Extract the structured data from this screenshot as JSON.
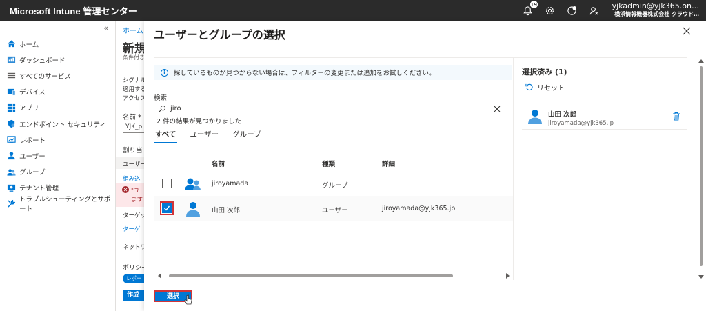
{
  "app": {
    "title": "Microsoft Intune 管理センター",
    "notification_count": "19",
    "account_name": "yjkadmin@yjk365.on…",
    "account_org": "横浜情報機器株式会社 クラウド…"
  },
  "nav": {
    "collapse_glyph": "«",
    "items": [
      {
        "label": "ホーム",
        "icon": "home-icon"
      },
      {
        "label": "ダッシュボード",
        "icon": "dashboard-icon"
      },
      {
        "label": "すべてのサービス",
        "icon": "list-icon"
      },
      {
        "label": "デバイス",
        "icon": "device-icon"
      },
      {
        "label": "アプリ",
        "icon": "apps-grid-icon"
      },
      {
        "label": "エンドポイント セキュリティ",
        "icon": "shield-icon"
      },
      {
        "label": "レポート",
        "icon": "report-icon"
      },
      {
        "label": "ユーザー",
        "icon": "user-icon"
      },
      {
        "label": "グループ",
        "icon": "group-icon"
      },
      {
        "label": "テナント管理",
        "icon": "tenant-icon"
      },
      {
        "label": "トラブルシューティングとサポート",
        "icon": "wrench-icon"
      }
    ]
  },
  "background_blade": {
    "breadcrumb": "ホーム >",
    "title": "新規",
    "subtitle": "条件付き",
    "desc1": "シグナル",
    "desc2": "適用する",
    "desc3": "アクセス",
    "name_label": "名前 *",
    "name_value": "YJK_p",
    "assign_label": "割り当て",
    "users_label": "ユーザー",
    "include_label": "組み込",
    "error1": "\"ユー",
    "error2": "ます",
    "target_label": "ターゲット",
    "target_link": "ターゲ",
    "network_label": "ネットワー",
    "policy_label": "ポリシー",
    "policy_pill": "レポー",
    "create_button": "作成"
  },
  "panel": {
    "title": "ユーザーとグループの選択",
    "info_text": "探しているものが見つからない場合は、フィルターの変更または追加をお試しください。",
    "search_label": "検索",
    "search_value": "jiro",
    "result_count": "2 件の結果が見つかりました",
    "tabs": [
      {
        "label": "すべて",
        "active": true
      },
      {
        "label": "ユーザー",
        "active": false
      },
      {
        "label": "グループ",
        "active": false
      }
    ],
    "columns": {
      "name": "名前",
      "type": "種類",
      "detail": "詳細"
    },
    "rows": [
      {
        "name": "jiroyamada",
        "type": "グループ",
        "detail": "",
        "checked": false
      },
      {
        "name": "山田 次郎",
        "type": "ユーザー",
        "detail": "jiroyamada@yjk365.jp",
        "checked": true
      }
    ],
    "selected_title": "選択済み (1)",
    "reset_label": "リセット",
    "selected_item": {
      "name": "山田 次郎",
      "email": "jiroyamada@yjk365.jp"
    },
    "select_button": "選択"
  },
  "colors": {
    "accent": "#0078d4",
    "topbar": "#2b2b2b",
    "highlight": "#d13438"
  }
}
